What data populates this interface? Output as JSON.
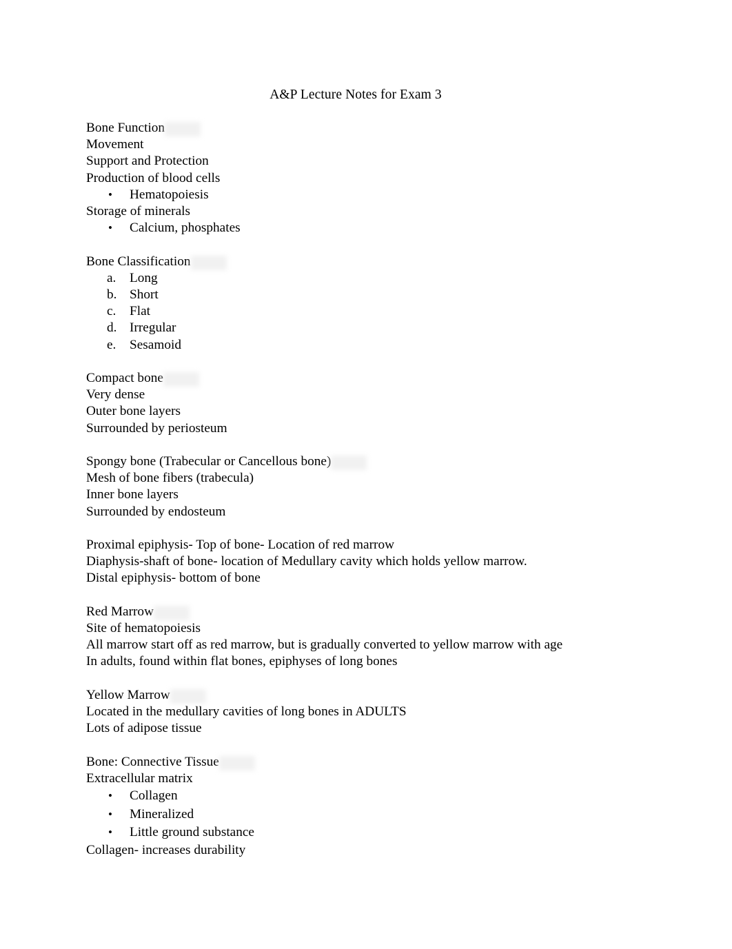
{
  "document": {
    "title": "A&P Lecture Notes for Exam 3"
  },
  "sections": [
    {
      "heading": "Bone Function",
      "lines": [
        "Movement",
        "Support and Protection",
        "Production of blood cells"
      ],
      "bullets_after_lines": [
        "Hematopoiesis"
      ],
      "trailing_line": "Storage of minerals",
      "trailing_bullets": [
        "Calcium, phosphates"
      ]
    },
    {
      "heading": "Bone Classification",
      "alpha_items": [
        {
          "marker": "a.",
          "label": "Long"
        },
        {
          "marker": "b.",
          "label": "Short"
        },
        {
          "marker": "c.",
          "label": "Flat"
        },
        {
          "marker": "d.",
          "label": "Irregular"
        },
        {
          "marker": "e.",
          "label": "Sesamoid"
        }
      ]
    },
    {
      "heading": "Compact bone",
      "lines": [
        "Very dense",
        "Outer bone layers",
        "Surrounded by periosteum"
      ]
    },
    {
      "heading": "Spongy bone (Trabecular or Cancellous bone)",
      "lines": [
        "Mesh of bone fibers (trabecula)",
        "Inner bone layers",
        "Surrounded by endosteum"
      ]
    },
    {
      "plain_lines": [
        "Proximal epiphysis- Top of bone- Location of red marrow",
        "Diaphysis-shaft of bone- location of Medullary cavity which holds yellow marrow.",
        "Distal epiphysis- bottom of bone"
      ]
    },
    {
      "heading": "Red Marrow",
      "lines": [
        "Site of hematopoiesis",
        "All marrow start off as red marrow, but is gradually converted to yellow marrow with age",
        "In adults, found within flat bones, epiphyses of long bones"
      ]
    },
    {
      "heading": "Yellow Marrow",
      "lines": [
        "Located in the medullary cavities of long bones in ADULTS",
        "Lots of adipose tissue"
      ]
    },
    {
      "heading": "Bone: Connective Tissue",
      "lines": [
        "Extracellular matrix"
      ],
      "bullets": [
        "Collagen",
        "Mineralized",
        "Little ground substance"
      ],
      "closing_line": "Collagen- increases durability"
    }
  ],
  "markers": {
    "bullet_glyph": "•"
  }
}
